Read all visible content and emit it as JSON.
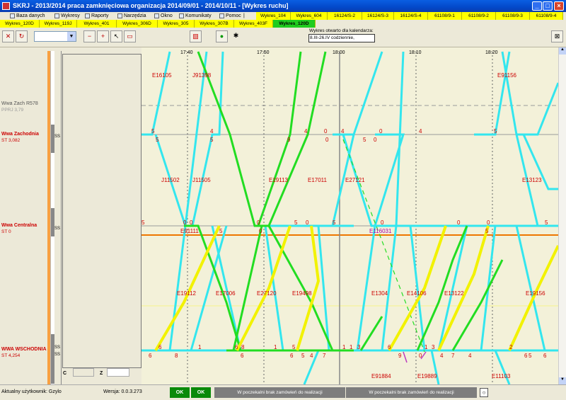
{
  "window": {
    "title": "SKRJ - 2013/2014 praca zamknięciowa organizacja 2014/09/01 - 2014/10/11 - [Wykres ruchu]",
    "minimize": "_",
    "maximize": "□",
    "close": "×"
  },
  "menu": {
    "items": [
      "Baza danych",
      "Wykresy",
      "Raporty",
      "Narzędzia",
      "Okno",
      "Komunikaty",
      "Pomoc"
    ],
    "separator": "|"
  },
  "tabs_row1": [
    "Wykres_104",
    "Wykres_604",
    "16124/S-2",
    "16124/S-3",
    "16124/S-4",
    "61108/9-1",
    "61108/9-2",
    "61108/9-3",
    "61108/9-4"
  ],
  "tabs_row2": [
    "Wykres_120D",
    "Wykres_119J",
    "Wykres_401",
    "Wykres_306D",
    "Wykres_305",
    "Wykres_307B",
    "Wykres_403F",
    "Wykres_120D"
  ],
  "toolbar": {
    "info_label": "Wykres otwarto dla kalendarza:",
    "info_value": "8.III-26.IV codziennie,"
  },
  "stations": [
    {
      "name": "Wwa Zach R578",
      "km": "PPRJ 3,79",
      "color": "#555555"
    },
    {
      "name": "Wwa Zachodnia",
      "km": "ST 3,082",
      "color": "#cc0000"
    },
    {
      "name": "Wwa Centralna",
      "km": "ST 0",
      "color": "#cc0000"
    },
    {
      "name": "WWA WSCHODNIA",
      "km": "ST 4,254",
      "color": "#cc0000"
    }
  ],
  "ss_labels": [
    "SS",
    "SS",
    "SS",
    "SS"
  ],
  "mid_labels": {
    "c": "C",
    "z": "Z"
  },
  "time_labels": [
    "17:40",
    "17:50",
    "18:00",
    "18:10",
    "18:20"
  ],
  "trains_top": [
    "E16105",
    "J91398",
    "E91156"
  ],
  "trains_mid1": [
    "J11502",
    "J11505",
    "E19113",
    "E17011",
    "E27121",
    "E13123"
  ],
  "trains_cent": [
    "E91111",
    "E116031"
  ],
  "trains_mid2": [
    "E19112",
    "E17006",
    "E27120",
    "E19498",
    "E1304",
    "E14106",
    "E13122",
    "E19156"
  ],
  "trains_bottom": [
    "E91884",
    "E19889",
    "E11103"
  ],
  "minutes_zach": [
    "5",
    "5",
    "4",
    "5",
    "4",
    "9",
    "0",
    "0",
    "4",
    "5",
    "0",
    "0",
    "4",
    "5"
  ],
  "minutes_cent": [
    "5",
    "0",
    "0",
    "5",
    "0",
    "0",
    "5",
    "0",
    "5",
    "0",
    "0",
    "5",
    "0",
    "5"
  ],
  "minutes_wsch": [
    "6",
    "1",
    "6",
    "8",
    "1",
    "5",
    "1",
    "1",
    "3",
    "6",
    "1",
    "3",
    "2"
  ],
  "minutes_wsch_lower": [
    "6",
    "8",
    "6",
    "6",
    "5",
    "4",
    "7",
    "9",
    "0",
    "4",
    "7",
    "4",
    "6",
    "5",
    "6"
  ],
  "statusbar": {
    "user": "Aktualny użytkownik: Gzylo",
    "version": "Wersja: 0.0.3.273",
    "ok1": "OK",
    "ok2": "OK",
    "msg1": "W poczekalni brak zamówień do realizacji",
    "msg2": "W poczekalni brak zamówień do realizacji",
    "btn": "○"
  },
  "colors": {
    "cyan": "#33e6ee",
    "green": "#22dd22",
    "yellow": "#f2f200",
    "orange": "#ee7700",
    "station_red": "#cc0000"
  }
}
